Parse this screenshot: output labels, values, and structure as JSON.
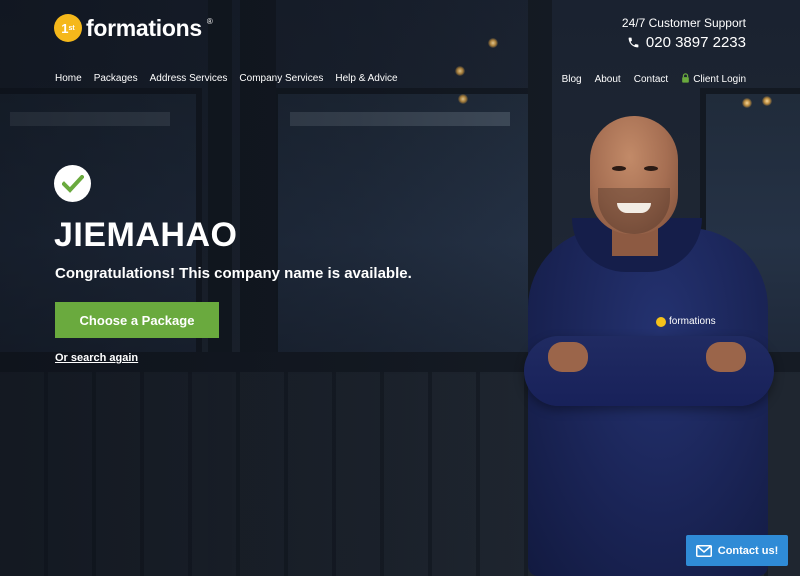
{
  "header": {
    "logo": {
      "badge": "1",
      "badge_sup": "st",
      "text": "formations",
      "reg": "®"
    },
    "support": {
      "label": "24/7 Customer Support",
      "phone": "020 3897 2233",
      "icon": "phone-icon"
    }
  },
  "nav": {
    "left": [
      "Home",
      "Packages",
      "Address Services",
      "Company Services",
      "Help & Advice"
    ],
    "right": {
      "blog": "Blog",
      "about": "About",
      "contact": "Contact",
      "client_login": "Client Login",
      "login_icon": "lock-icon"
    }
  },
  "result": {
    "status_icon": "check-icon",
    "company_name": "JIEMAHAO",
    "message": "Congratulations! This company name is available.",
    "primary_cta": "Choose a Package",
    "secondary_link": "Or search again"
  },
  "hoodie_logo": "formations",
  "contact_widget": {
    "label": "Contact us!",
    "icon": "mail-icon"
  },
  "colors": {
    "accent_green": "#6aaa3e",
    "brand_yellow": "#f5b81b",
    "widget_blue": "#2f8bd6",
    "login_icon_green": "#6aaa3e"
  }
}
